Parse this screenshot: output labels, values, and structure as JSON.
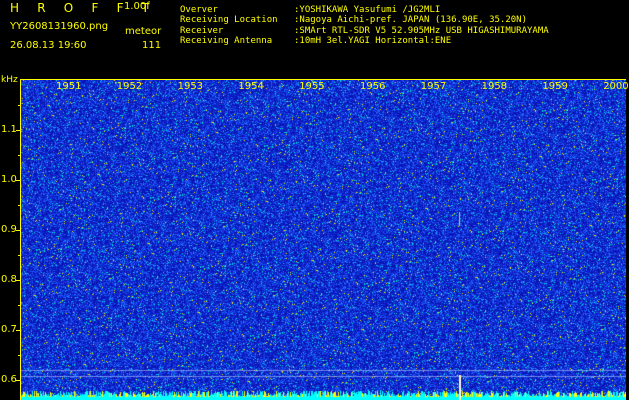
{
  "header": {
    "app_title": "H R O F F T",
    "app_version": "1.00f",
    "file_name": "YY2608131960.png",
    "datetime": "26.08.13 19:60",
    "mode": "meteor",
    "count": "111"
  },
  "station_info": [
    {
      "label": "Overver",
      "value": ":YOSHIKAWA Yasufumi /JG2MLI"
    },
    {
      "label": "Receiving Location",
      "value": ":Nagoya Aichi-pref. JAPAN (136.90E, 35.20N)"
    },
    {
      "label": "Receiver",
      "value": ":SMArt RTL-SDR V5 52.905MHz USB HIGASHIMURAYAMA"
    },
    {
      "label": "Receiving Antenna",
      "value": ":10mH 3el.YAGI Horizontal:ENE"
    }
  ],
  "spectrogram": {
    "y_unit": "kHz",
    "y_ticks": [
      "1.1",
      "1.0",
      "0.9",
      "0.8",
      "0.7",
      "0.6"
    ],
    "y_values": [
      1.1,
      1.0,
      0.9,
      0.8,
      0.7,
      0.6
    ],
    "time_labels": [
      "1951",
      "1952",
      "1953",
      "1954",
      "1955",
      "1956",
      "1957",
      "1958",
      "1959",
      "2000"
    ],
    "colors": {
      "background": "#0a14b4",
      "noise_bright": "#1e64ff",
      "noise_cyan": "#00dcdc",
      "noise_yellow": "#f0f000",
      "axis": "#ffff00",
      "carrier_band": "#00ffff"
    }
  }
}
